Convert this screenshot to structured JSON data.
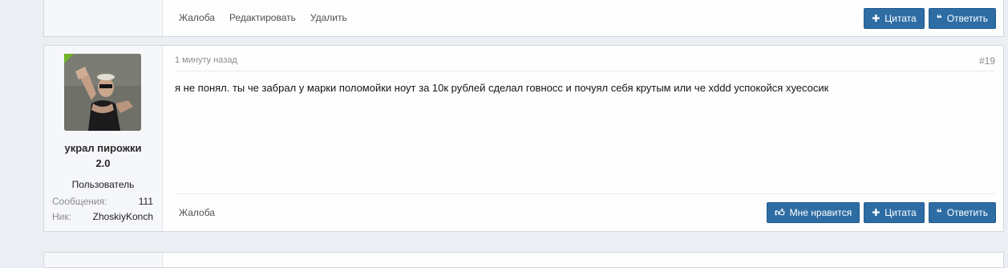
{
  "top_post": {
    "links": {
      "report": "Жалоба",
      "edit": "Редактировать",
      "delete": "Удалить"
    },
    "buttons": {
      "quote": "Цитата",
      "reply": "Ответить"
    }
  },
  "post": {
    "time": "1 минуту назад",
    "number": "#19",
    "message": "я не понял. ты че забрал у марки поломойки ноут за 10к рублей сделал говносс и почуял себя крутым или че xddd успокойся хуесосик",
    "user": {
      "name_line1": "украл пирожки",
      "name_line2": "2.0",
      "title": "Пользователь",
      "messages_label": "Сообщения:",
      "messages_value": "111",
      "nick_label": "Ник:",
      "nick_value": "ZhoskiyKonch",
      "online": true
    },
    "links": {
      "report": "Жалоба"
    },
    "buttons": {
      "like": "Мне нравится",
      "quote": "Цитата",
      "reply": "Ответить"
    }
  },
  "icons": {
    "plus": "plus-icon",
    "quote": "quote-icon",
    "thumb": "thumbs-up-icon"
  },
  "colors": {
    "button": "#2e6da4",
    "online": "#72b329",
    "background": "#ebeef2"
  }
}
